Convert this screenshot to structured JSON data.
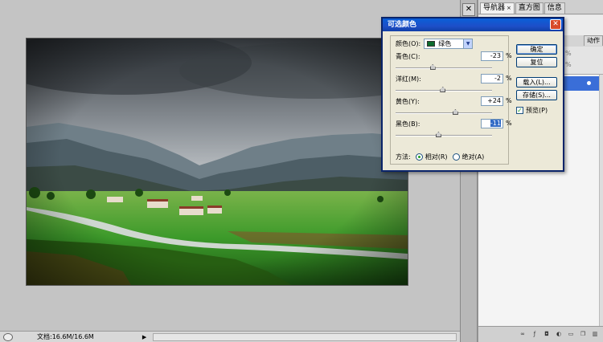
{
  "status": {
    "doc_info": "文档:16.6M/16.6M"
  },
  "panels": {
    "tabs": [
      {
        "label": "导航器",
        "has_close": true,
        "active": true
      },
      {
        "label": "直方图",
        "has_close": false,
        "active": false
      },
      {
        "label": "信息",
        "has_close": false,
        "active": false
      }
    ],
    "second_tab_label": "动作",
    "pct_placeholder": "%",
    "footer_icons": [
      "link-icon",
      "fx-icon",
      "mask-icon",
      "adjustment-icon",
      "group-icon",
      "new-layer-icon",
      "trash-icon"
    ]
  },
  "dialog": {
    "title": "可选颜色",
    "close_glyph": "✕",
    "colors_label": "颜色(O):",
    "colors_value": "绿色",
    "colors_swatch": "#0c6b2c",
    "sliders": [
      {
        "label": "青色(C):",
        "value": "-23",
        "unit": "%",
        "level": -23
      },
      {
        "label": "洋红(M):",
        "value": "-2",
        "unit": "%",
        "level": -2
      },
      {
        "label": "黄色(Y):",
        "value": "+24",
        "unit": "%",
        "level": 24
      },
      {
        "label": "黑色(B):",
        "value": "-11",
        "unit": "%",
        "level": -11
      }
    ],
    "method_label": "方法:",
    "method_options": [
      {
        "label": "相对(R)",
        "selected": true
      },
      {
        "label": "绝对(A)",
        "selected": false
      }
    ],
    "buttons": {
      "ok": "确定",
      "reset": "复位",
      "load": "载入(L)...",
      "save": "存储(S)..."
    },
    "preview_label": "预览(P)",
    "preview_checked": true
  }
}
